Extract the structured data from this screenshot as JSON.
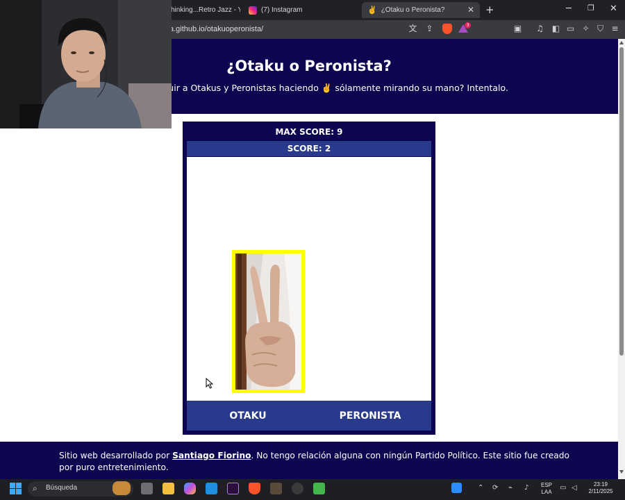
{
  "browser": {
    "tabs": [
      {
        "label": "hinking...Retro Jazz - You",
        "active": false
      },
      {
        "label": "(7) Instagram",
        "active": false
      },
      {
        "label": "¿Otaku o Peronista?",
        "active": true
      }
    ],
    "url": "a.github.io/otakuoperonista/",
    "rewards_badge": "3"
  },
  "page": {
    "title": "¿Otaku o Peronista?",
    "subtitle": "tinguir a Otakus y Peronistas haciendo ✌️ sólamente mirando su mano? Intentalo."
  },
  "game": {
    "max_score_label": "MAX SCORE: 9",
    "score_label": "SCORE: 2",
    "buttons": {
      "otaku": "OTAKU",
      "peronista": "PERONISTA"
    },
    "image_alt": "hand making a V sign"
  },
  "footer": {
    "prefix": "Sitio web desarrollado por ",
    "author": "Santiago Fiorino",
    "suffix": ". No tengo relación alguna con ningún Partido Político. Este sitio fue creado por puro entretenimiento."
  },
  "taskbar": {
    "search_placeholder": "Búsqueda",
    "lang_top": "ESP",
    "lang_bottom": "LAA",
    "time": "23:19",
    "date": "2/11/2025"
  },
  "colors": {
    "header_bg": "#0d0550",
    "bar_bg": "#29398b",
    "frame": "#ffff00",
    "text": "#ffffff"
  }
}
